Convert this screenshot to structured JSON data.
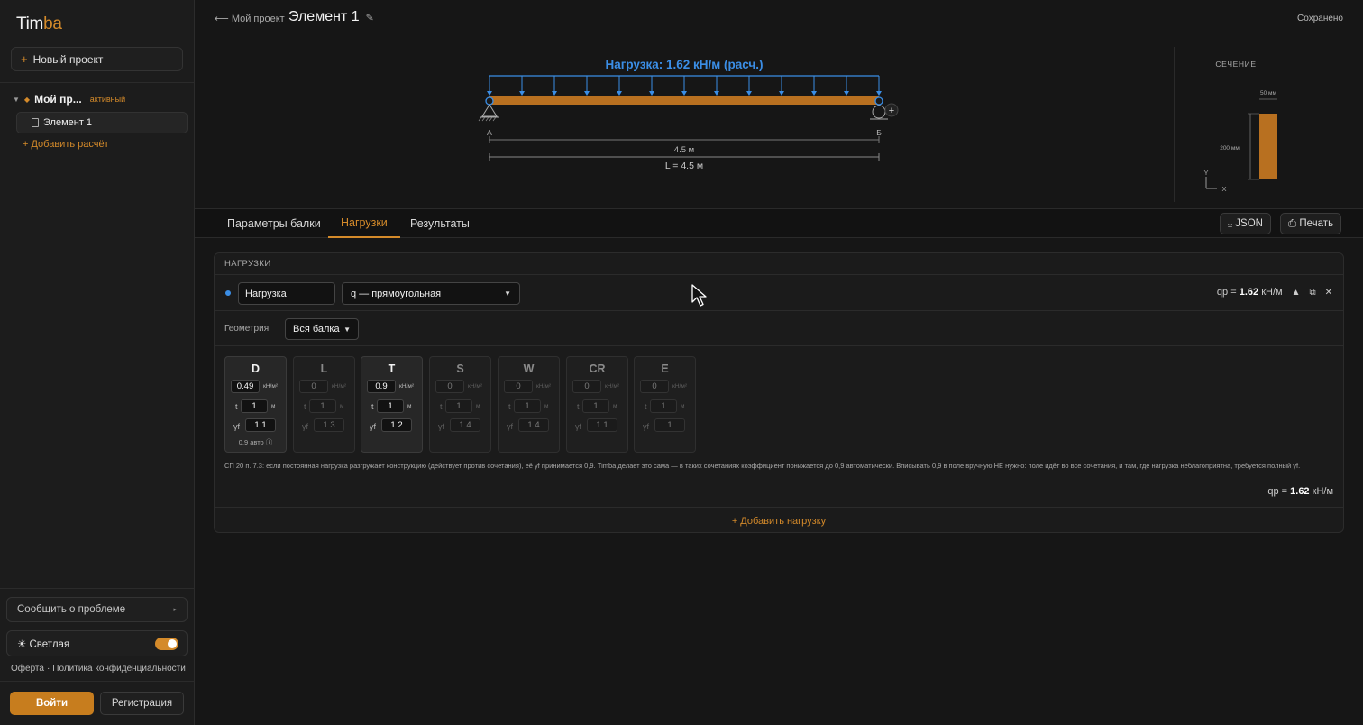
{
  "app": {
    "logo_main": "Tim",
    "logo_accent": "ba"
  },
  "sidebar": {
    "new_project": "Новый проект",
    "project": {
      "name": "Мой пр...",
      "badge": "активный"
    },
    "element": "Элемент 1",
    "add_calc": "+ Добавить расчёт",
    "report": "Сообщить о проблеме",
    "theme": "☀ Светлая",
    "legal_offer": "Оферта",
    "legal_sep": "·",
    "legal_privacy": "Политика конфиденциальности",
    "login": "Войти",
    "register": "Регистрация"
  },
  "topbar": {
    "back": "⟵ Мой проект",
    "title": "Элемент 1",
    "saved": "Сохранено"
  },
  "diagram": {
    "load_label": "Нагрузка: 1.62 кН/м (расч.)",
    "support_a": "А",
    "support_b": "Б",
    "span_label": "4.5 м",
    "total_label": "L = 4.5 м"
  },
  "section": {
    "title": "СЕЧЕНИЕ",
    "width_label": "50 мм",
    "height_label": "200 мм",
    "axis_y": "Y",
    "axis_x": "X"
  },
  "tabs": [
    {
      "label": "Параметры балки"
    },
    {
      "label": "Нагрузки"
    },
    {
      "label": "Результаты"
    }
  ],
  "actions": {
    "json": "⤓ JSON",
    "print": "⎙ Печать"
  },
  "loads": {
    "header": "НАГРУЗКИ",
    "name_value": "Нагрузка",
    "type_value": "q — прямоугольная",
    "qp_prefix": "qp =",
    "qp_value": "1.62",
    "qp_unit": "кН/м",
    "geometry_label": "Геометрия",
    "geometry_value": "Вся балка",
    "cards": [
      {
        "code": "D",
        "value": "0.49",
        "unit": "кН/м²",
        "t": "1",
        "t_unit": "м",
        "gf": "1.1",
        "auto": "0.9 авто ⓘ",
        "on": true
      },
      {
        "code": "L",
        "value": "0",
        "unit": "кН/м²",
        "t": "1",
        "t_unit": "м",
        "gf": "1.3",
        "auto": "",
        "on": false
      },
      {
        "code": "T",
        "value": "0.9",
        "unit": "кН/м²",
        "t": "1",
        "t_unit": "м",
        "gf": "1.2",
        "auto": "",
        "on": true
      },
      {
        "code": "S",
        "value": "0",
        "unit": "кН/м²",
        "t": "1",
        "t_unit": "м",
        "gf": "1.4",
        "auto": "",
        "on": false
      },
      {
        "code": "W",
        "value": "0",
        "unit": "кН/м²",
        "t": "1",
        "t_unit": "м",
        "gf": "1.4",
        "auto": "",
        "on": false
      },
      {
        "code": "CR",
        "value": "0",
        "unit": "кН/м²",
        "t": "1",
        "t_unit": "м",
        "gf": "1.1",
        "auto": "",
        "on": false
      },
      {
        "code": "E",
        "value": "0",
        "unit": "кН/м²",
        "t": "1",
        "t_unit": "м",
        "gf": "1",
        "auto": "",
        "on": false
      }
    ],
    "t_label": "t",
    "gf_label": "γf",
    "note": "СП 20 п. 7.3: если постоянная нагрузка разгружает конструкцию (действует против сочетания), её γf принимается 0,9. Timba делает это сама — в таких сочетаниях коэффициент понижается до 0,9 автоматически. Вписывать 0,9 в поле вручную НЕ нужно: поле идёт во все сочетания, и там, где нагрузка неблагоприятна, требуется полный γf.",
    "total_prefix": "qp =",
    "total_value": "1.62",
    "total_unit": "кН/м",
    "add_load": "+ Добавить нагрузку"
  },
  "colors": {
    "accent": "#d48a2a",
    "load_blue": "#3b8ee6",
    "beam": "#b87020"
  }
}
